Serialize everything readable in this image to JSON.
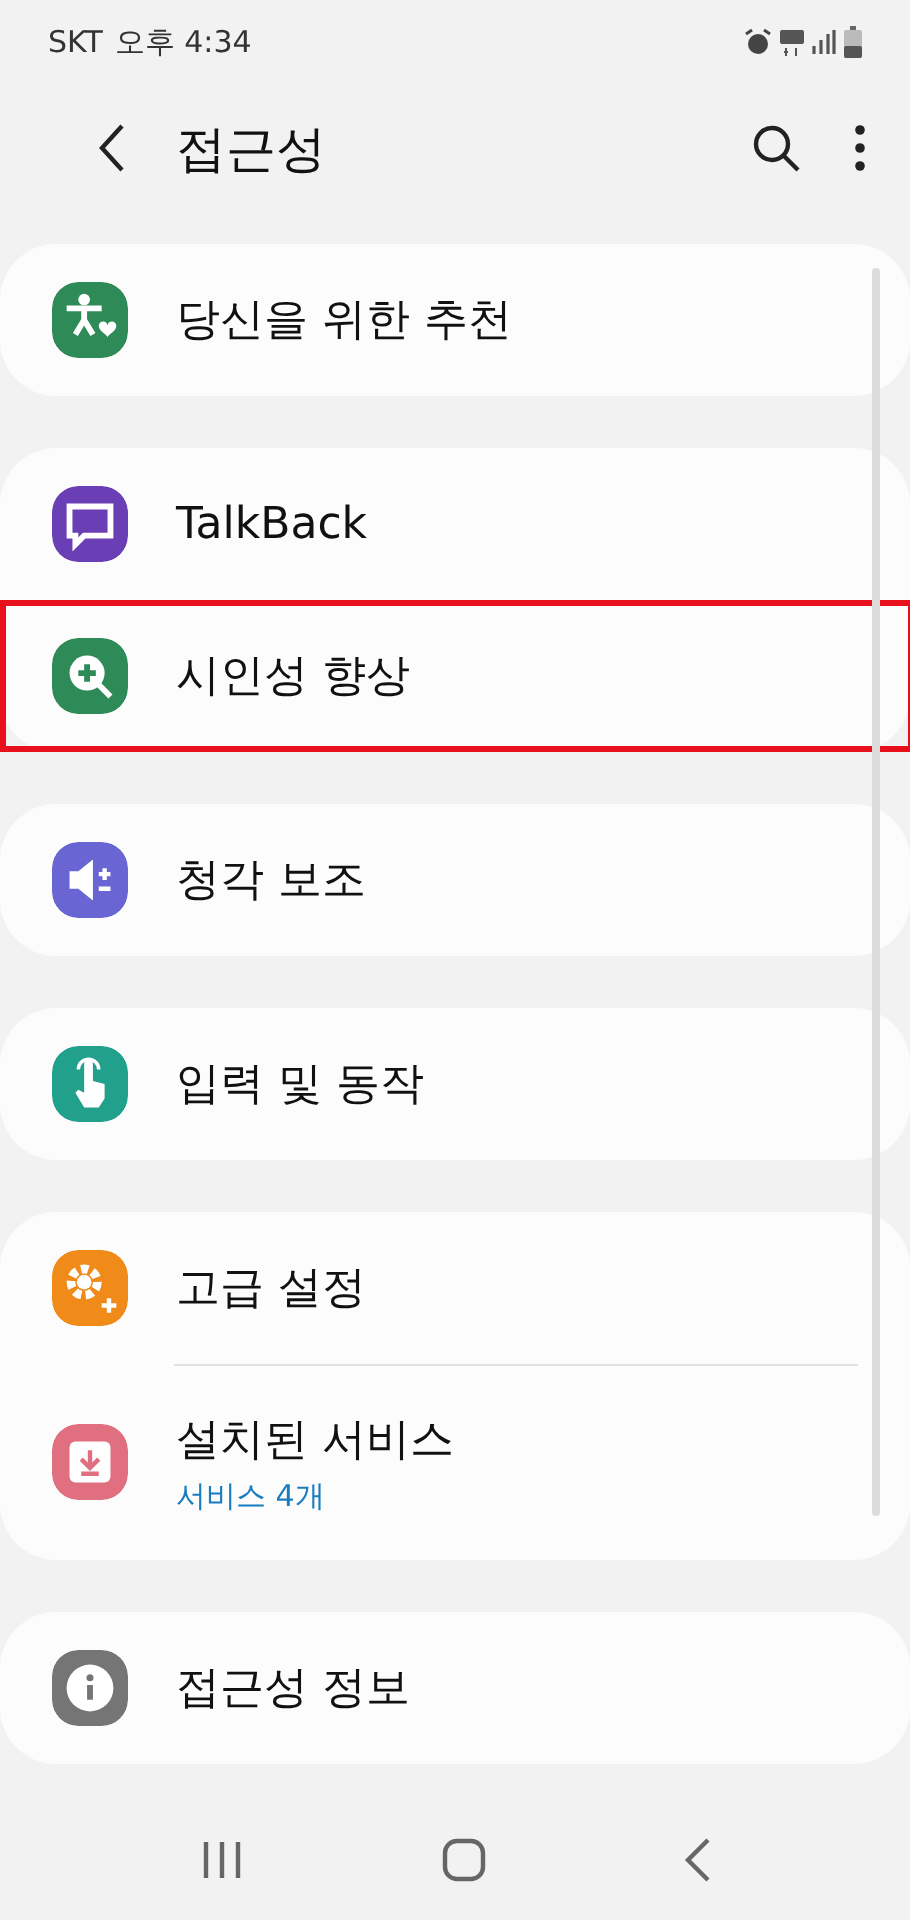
{
  "status_bar": {
    "carrier": "SKT",
    "time": "오후 4:34"
  },
  "header": {
    "title": "접근성"
  },
  "groups": [
    {
      "items": [
        {
          "kind": "person",
          "color": "#2e8a57",
          "label": "당신을 위한 추천",
          "highlighted": false
        }
      ]
    },
    {
      "items": [
        {
          "kind": "chat",
          "color": "#6a3fb5",
          "label": "TalkBack",
          "highlighted": false
        },
        {
          "kind": "zoom",
          "color": "#2e8a57",
          "label": "시인성 향상",
          "highlighted": true
        }
      ]
    },
    {
      "items": [
        {
          "kind": "volume",
          "color": "#6966d4",
          "label": "청각 보조",
          "highlighted": false
        }
      ]
    },
    {
      "items": [
        {
          "kind": "hand",
          "color": "#21a08c",
          "label": "입력 및 동작",
          "highlighted": false
        }
      ]
    },
    {
      "items": [
        {
          "kind": "gear",
          "color": "#f08a18",
          "label": "고급 설정",
          "highlighted": false
        },
        {
          "kind": "download",
          "color": "#e07080",
          "label": "설치된 서비스",
          "sub": "서비스 4개",
          "highlighted": false
        }
      ]
    },
    {
      "items": [
        {
          "kind": "info",
          "color": "#757575",
          "label": "접근성 정보",
          "highlighted": false
        }
      ]
    }
  ]
}
